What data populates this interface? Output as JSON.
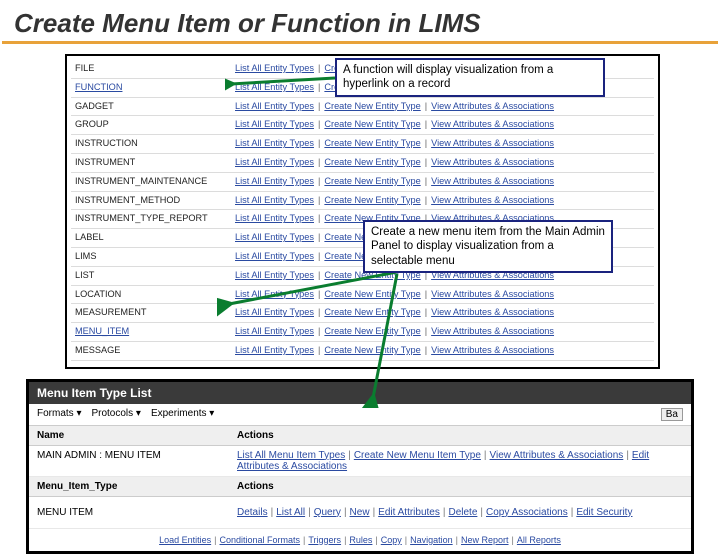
{
  "title": "Create Menu Item or Function in LIMS",
  "callouts": {
    "c1": "A function will display visualization from a hyperlink on a record",
    "c2": "Create a new menu item from the Main Admin Panel  to display visualization from a selectable menu"
  },
  "actions": {
    "list": "List All Entity Types",
    "create": "Create New Entity Type",
    "view": "View Attributes & Associations"
  },
  "rows": [
    {
      "name": "FILE"
    },
    {
      "name": "FUNCTION",
      "link": true
    },
    {
      "name": "GADGET"
    },
    {
      "name": "GROUP"
    },
    {
      "name": "INSTRUCTION"
    },
    {
      "name": "INSTRUMENT"
    },
    {
      "name": "INSTRUMENT_MAINTENANCE"
    },
    {
      "name": "INSTRUMENT_METHOD"
    },
    {
      "name": "INSTRUMENT_TYPE_REPORT"
    },
    {
      "name": "LABEL"
    },
    {
      "name": "LIMS"
    },
    {
      "name": "LIST"
    },
    {
      "name": "LOCATION"
    },
    {
      "name": "MEASUREMENT"
    },
    {
      "name": "MENU_ITEM",
      "link": true
    },
    {
      "name": "MESSAGE"
    }
  ],
  "panel2": {
    "title": "Menu Item Type List",
    "toolbar": [
      "Formats ▾",
      "Protocols ▾",
      "Experiments ▾"
    ],
    "batchBtn": "Ba",
    "head": {
      "name": "Name",
      "actions": "Actions"
    },
    "row1": {
      "name": "MAIN ADMIN : MENU ITEM",
      "acts": [
        "List All Menu Item Types",
        "Create New Menu Item Type",
        "View Attributes & Associations",
        "Edit Attributes & Associations"
      ]
    },
    "subhead": {
      "name": "Menu_Item_Type",
      "actions": "Actions"
    },
    "row2": {
      "name": "MENU ITEM",
      "acts": [
        "Details",
        "List All",
        "Query",
        "New",
        "Edit Attributes",
        "Delete",
        "Copy Associations",
        "Edit Security"
      ]
    },
    "footer": [
      "Load Entities",
      "Conditional Formats",
      "Triggers",
      "Rules",
      "Copy",
      "Navigation",
      "New Report",
      "All Reports"
    ]
  }
}
